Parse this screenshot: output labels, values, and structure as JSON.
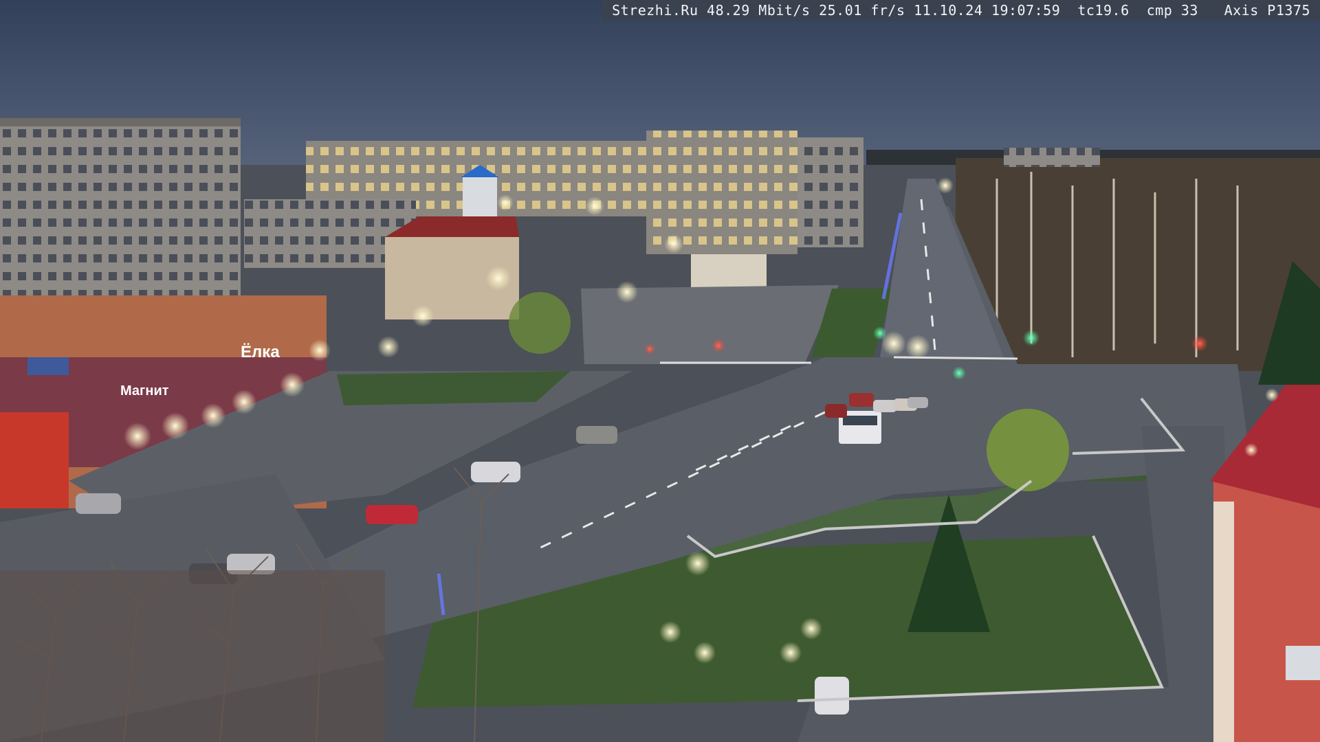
{
  "camera_overlay": {
    "site": "Strezhi.Ru",
    "bitrate": "48.29 Mbit/s",
    "framerate": "25.01 fr/s",
    "date": "11.10.24",
    "time": "19:07:59",
    "tc": "tc19.6",
    "cmp": "cmp 33",
    "camera_model": "Axis P1375"
  },
  "storefront_signs": [
    "Ёлка",
    "Магнит"
  ],
  "colors": {
    "sky": "#3a4660",
    "sky_low": "#4a5670",
    "road": "#5c6068",
    "grass": "#3e5a34",
    "lamp": "#fffbe0",
    "red_building": "#b83a2a"
  }
}
